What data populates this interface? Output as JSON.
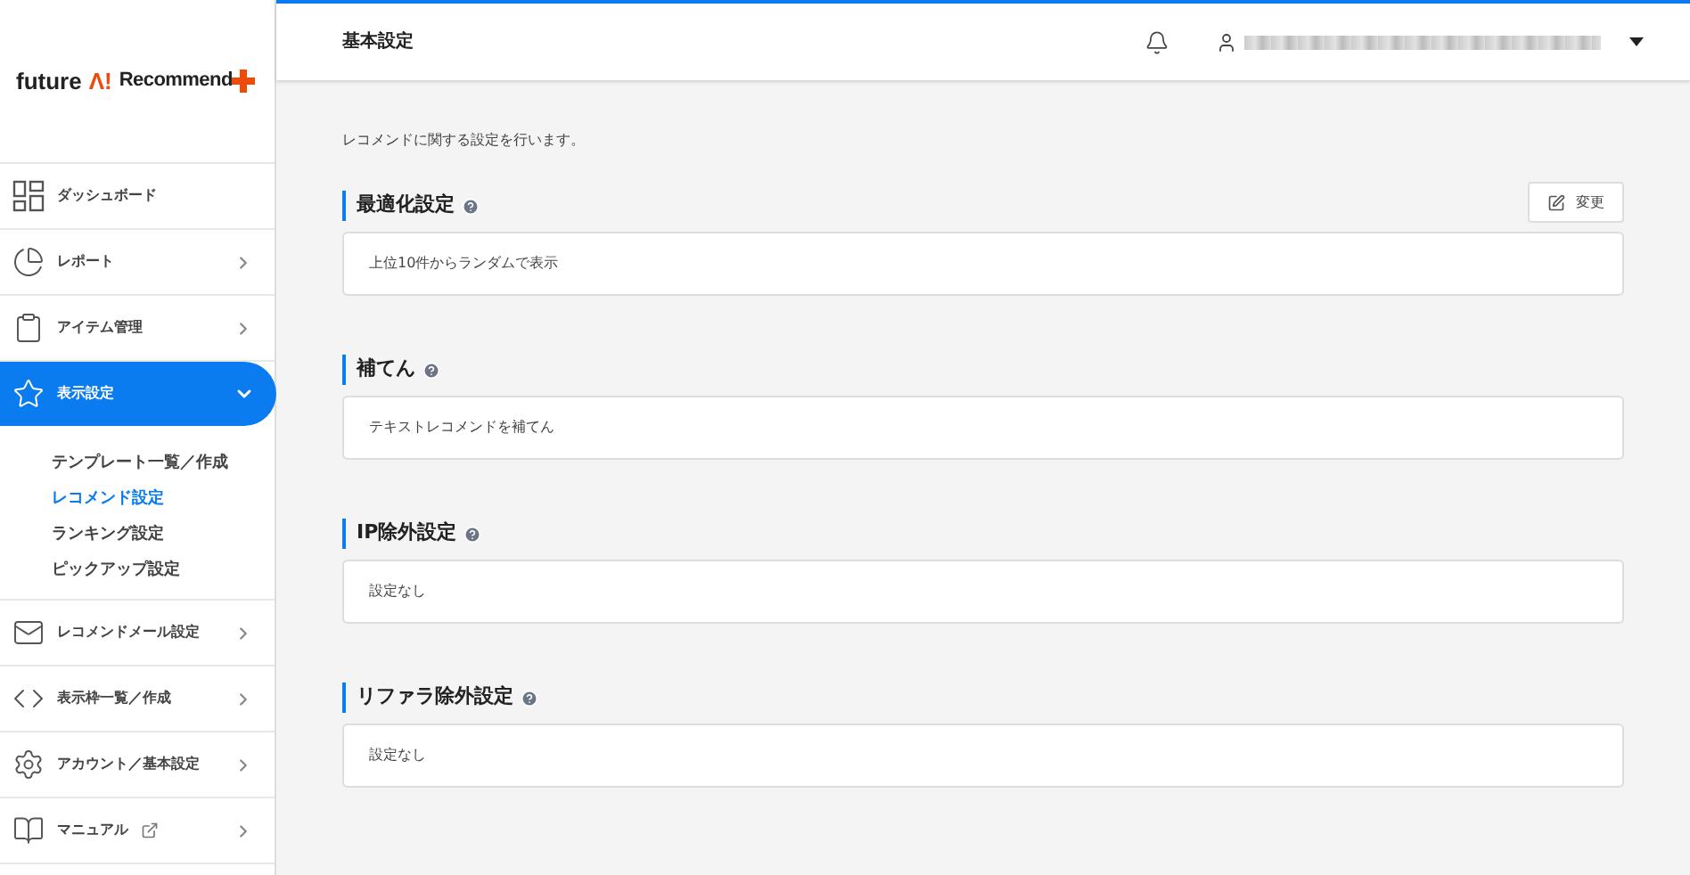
{
  "logo": {
    "word_1": "future",
    "word_2": "Λ!",
    "word_3": "Recommend"
  },
  "sidebar": {
    "items": [
      {
        "label": "ダッシュボード",
        "kind": "page",
        "selected": false,
        "external": false
      },
      {
        "label": "レポート",
        "kind": "group",
        "selected": false,
        "expanded": false,
        "external": false
      },
      {
        "label": "アイテム管理",
        "kind": "group",
        "selected": false,
        "expanded": false,
        "external": false
      },
      {
        "label": "表示設定",
        "kind": "group",
        "selected": true,
        "expanded": true,
        "external": false,
        "children": [
          {
            "label": "テンプレート一覧／作成",
            "selected": false
          },
          {
            "label": "レコメンド設定",
            "selected": true
          },
          {
            "label": "ランキング設定",
            "selected": false
          },
          {
            "label": "ピックアップ設定",
            "selected": false
          }
        ]
      },
      {
        "label": "レコメンドメール設定",
        "kind": "group",
        "selected": false,
        "expanded": false,
        "external": false
      },
      {
        "label": "表示枠一覧／作成",
        "kind": "group",
        "selected": false,
        "expanded": false,
        "external": false
      },
      {
        "label": "アカウント／基本設定",
        "kind": "group",
        "selected": false,
        "expanded": false,
        "external": false
      },
      {
        "label": "マニュアル",
        "kind": "group",
        "selected": false,
        "expanded": false,
        "external": true
      }
    ]
  },
  "header": {
    "title": "基本設定"
  },
  "page": {
    "description": "レコメンドに関する設定を行います。",
    "edit_button": "変更",
    "sections": [
      {
        "title": "最適化設定",
        "value": "上位10件からランダムで表示"
      },
      {
        "title": "補てん",
        "value": "テキストレコメンドを補てん"
      },
      {
        "title": "IP除外設定",
        "value": "設定なし"
      },
      {
        "title": "リファラ除外設定",
        "value": "設定なし"
      }
    ]
  }
}
